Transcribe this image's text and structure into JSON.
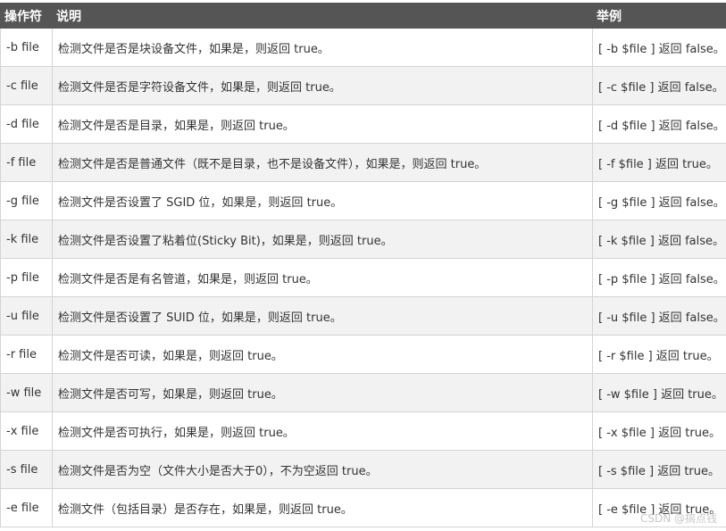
{
  "table": {
    "headers": [
      "操作符",
      "说明",
      "举例"
    ],
    "rows": [
      {
        "op": "-b file",
        "desc": "检测文件是否是块设备文件，如果是，则返回 true。",
        "example": "[ -b $file ] 返回 false。"
      },
      {
        "op": "-c file",
        "desc": "检测文件是否是字符设备文件，如果是，则返回 true。",
        "example": "[ -c $file ] 返回 false。"
      },
      {
        "op": "-d file",
        "desc": "检测文件是否是目录，如果是，则返回 true。",
        "example": "[ -d $file ] 返回 false。"
      },
      {
        "op": "-f file",
        "desc": "检测文件是否是普通文件（既不是目录，也不是设备文件），如果是，则返回 true。",
        "example": "[ -f $file ] 返回 true。"
      },
      {
        "op": "-g file",
        "desc": "检测文件是否设置了 SGID 位，如果是，则返回 true。",
        "example": "[ -g $file ] 返回 false。"
      },
      {
        "op": "-k file",
        "desc": "检测文件是否设置了粘着位(Sticky Bit)，如果是，则返回 true。",
        "example": "[ -k $file ] 返回 false。"
      },
      {
        "op": "-p file",
        "desc": "检测文件是否是有名管道，如果是，则返回 true。",
        "example": "[ -p $file ] 返回 false。"
      },
      {
        "op": "-u file",
        "desc": "检测文件是否设置了 SUID 位，如果是，则返回 true。",
        "example": "[ -u $file ] 返回 false。"
      },
      {
        "op": "-r file",
        "desc": "检测文件是否可读，如果是，则返回 true。",
        "example": "[ -r $file ] 返回 true。"
      },
      {
        "op": "-w file",
        "desc": "检测文件是否可写，如果是，则返回 true。",
        "example": "[ -w $file ] 返回 true。"
      },
      {
        "op": "-x file",
        "desc": "检测文件是否可执行，如果是，则返回 true。",
        "example": "[ -x $file ] 返回 true。"
      },
      {
        "op": "-s file",
        "desc": "检测文件是否为空（文件大小是否大于0），不为空返回 true。",
        "example": "[ -s $file ] 返回 true。"
      },
      {
        "op": "-e file",
        "desc": "检测文件（包括目录）是否存在，如果是，则返回 true。",
        "example": "[ -e $file ] 返回 true。"
      }
    ]
  },
  "watermark": "CSDN @搞点钱",
  "colors": {
    "header_bg": "#555555",
    "header_text": "#ffffff",
    "row_odd": "#ffffff",
    "row_even": "#f2f2f2",
    "border": "#d4d4d4",
    "text": "#333333"
  }
}
